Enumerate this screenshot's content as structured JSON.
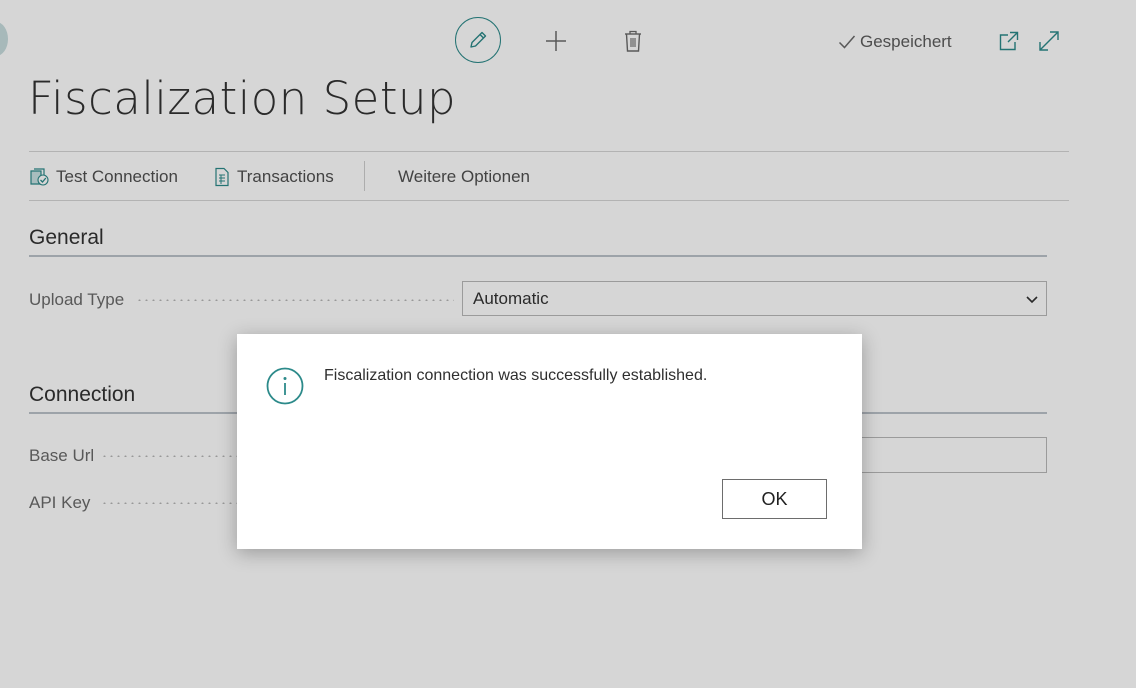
{
  "toolbar": {
    "edit_icon": "pencil-icon",
    "new_icon": "plus-icon",
    "delete_icon": "trash-icon",
    "saved_icon": "checkmark-icon",
    "saved_label": "Gespeichert",
    "open_new_window_icon": "open-in-new-window-icon",
    "expand_icon": "expand-icon"
  },
  "page": {
    "title": "Fiscalization Setup"
  },
  "actions": {
    "test_connection_label": "Test Connection",
    "transactions_label": "Transactions",
    "more_options_label": "Weitere Optionen"
  },
  "sections": {
    "general": {
      "title": "General",
      "upload_type_label": "Upload Type",
      "upload_type_value": "Automatic"
    },
    "connection": {
      "title": "Connection",
      "base_url_label": "Base Url",
      "api_key_label": "API Key"
    }
  },
  "dialog": {
    "icon": "info-icon",
    "message": "Fiscalization connection was successfully established.",
    "ok_label": "OK"
  },
  "colors": {
    "accent": "#2c8a8a",
    "overlay": "rgba(0,0,0,0.16)"
  }
}
